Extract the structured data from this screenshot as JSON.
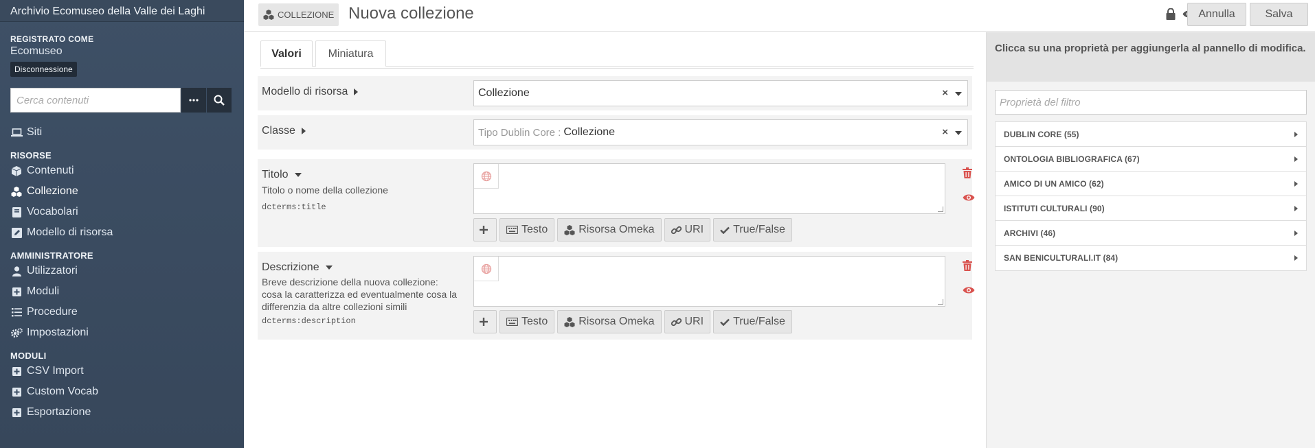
{
  "sidebar": {
    "site_title": "Archivio Ecomuseo della Valle dei Laghi",
    "user_label": "REGISTRATO COME",
    "user_name": "Ecomuseo",
    "logout_label": "Disconnessione",
    "search_placeholder": "Cerca contenuti",
    "items_top": [
      {
        "label": "Siti",
        "icon": "laptop-icon"
      }
    ],
    "risorse_heading": "RISORSE",
    "risorse": [
      {
        "label": "Contenuti",
        "icon": "cube-icon"
      },
      {
        "label": "Collezione",
        "icon": "cubes-icon",
        "active": true
      },
      {
        "label": "Vocabolari",
        "icon": "book-icon"
      },
      {
        "label": "Modello di risorsa",
        "icon": "edit-icon"
      }
    ],
    "admin_heading": "AMMINISTRATORE",
    "admin": [
      {
        "label": "Utilizzatori",
        "icon": "user-icon"
      },
      {
        "label": "Moduli",
        "icon": "plus-square-icon"
      },
      {
        "label": "Procedure",
        "icon": "list-icon"
      },
      {
        "label": "Impostazioni",
        "icon": "cogs-icon"
      }
    ],
    "moduli_heading": "MODULI",
    "moduli": [
      {
        "label": "CSV Import",
        "icon": "plus-square-icon"
      },
      {
        "label": "Custom Vocab",
        "icon": "plus-square-icon"
      },
      {
        "label": "Esportazione",
        "icon": "plus-square-icon"
      }
    ]
  },
  "header": {
    "resource_type": "COLLEZIONE",
    "title": "Nuova collezione",
    "cancel_label": "Annulla",
    "save_label": "Salva"
  },
  "tabs": [
    {
      "label": "Valori",
      "active": true
    },
    {
      "label": "Miniatura",
      "active": false
    }
  ],
  "fields": {
    "template": {
      "label": "Modello di risorsa",
      "value": "Collezione"
    },
    "class": {
      "label": "Classe",
      "prefix": "Tipo Dublin Core :",
      "value": "Collezione"
    },
    "title": {
      "label": "Titolo",
      "description": "Titolo o nome della collezione",
      "term": "dcterms:title",
      "value": ""
    },
    "description": {
      "label": "Descrizione",
      "description": "Breve descrizione della nuova collezione: cosa la caratterizza ed eventualmente cosa la differenzia da altre collezioni simili",
      "term": "dcterms:description",
      "value": ""
    }
  },
  "value_buttons": {
    "text": "Testo",
    "omeka": "Risorsa Omeka",
    "uri": "URI",
    "truefalse": "True/False"
  },
  "right_panel": {
    "heading": "Clicca su una proprietà per aggiungerla al pannello di modifica.",
    "filter_placeholder": "Proprietà del filtro",
    "vocabularies": [
      "DUBLIN CORE (55)",
      "ONTOLOGIA BIBLIOGRAFICA (67)",
      "AMICO DI UN AMICO (62)",
      "ISTITUTI CULTURALI (90)",
      "ARCHIVI (46)",
      "SAN BENICULTURALI.IT (84)"
    ]
  },
  "colors": {
    "sidebar_bg": "#3e5066",
    "delete_red": "#d9534f",
    "panel_bg": "#f3f3f3"
  }
}
